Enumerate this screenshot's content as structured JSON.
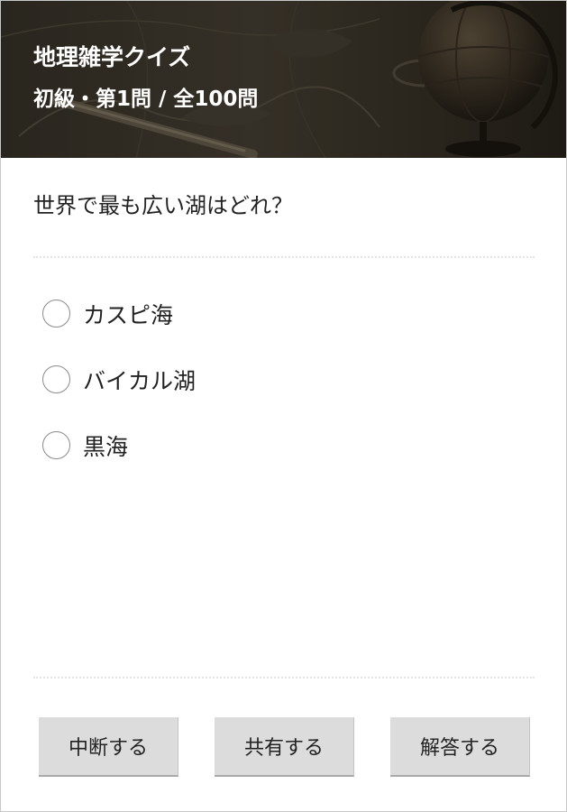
{
  "header": {
    "title": "地理雑学クイズ",
    "progress": "初級・第1問 / 全100問"
  },
  "question": {
    "text": "世界で最も広い湖はどれ？"
  },
  "options": [
    {
      "label": "カスピ海",
      "selected": false
    },
    {
      "label": "バイカル湖",
      "selected": false
    },
    {
      "label": "黒海",
      "selected": false
    }
  ],
  "buttons": {
    "suspend": "中断する",
    "share": "共有する",
    "answer": "解答する"
  }
}
